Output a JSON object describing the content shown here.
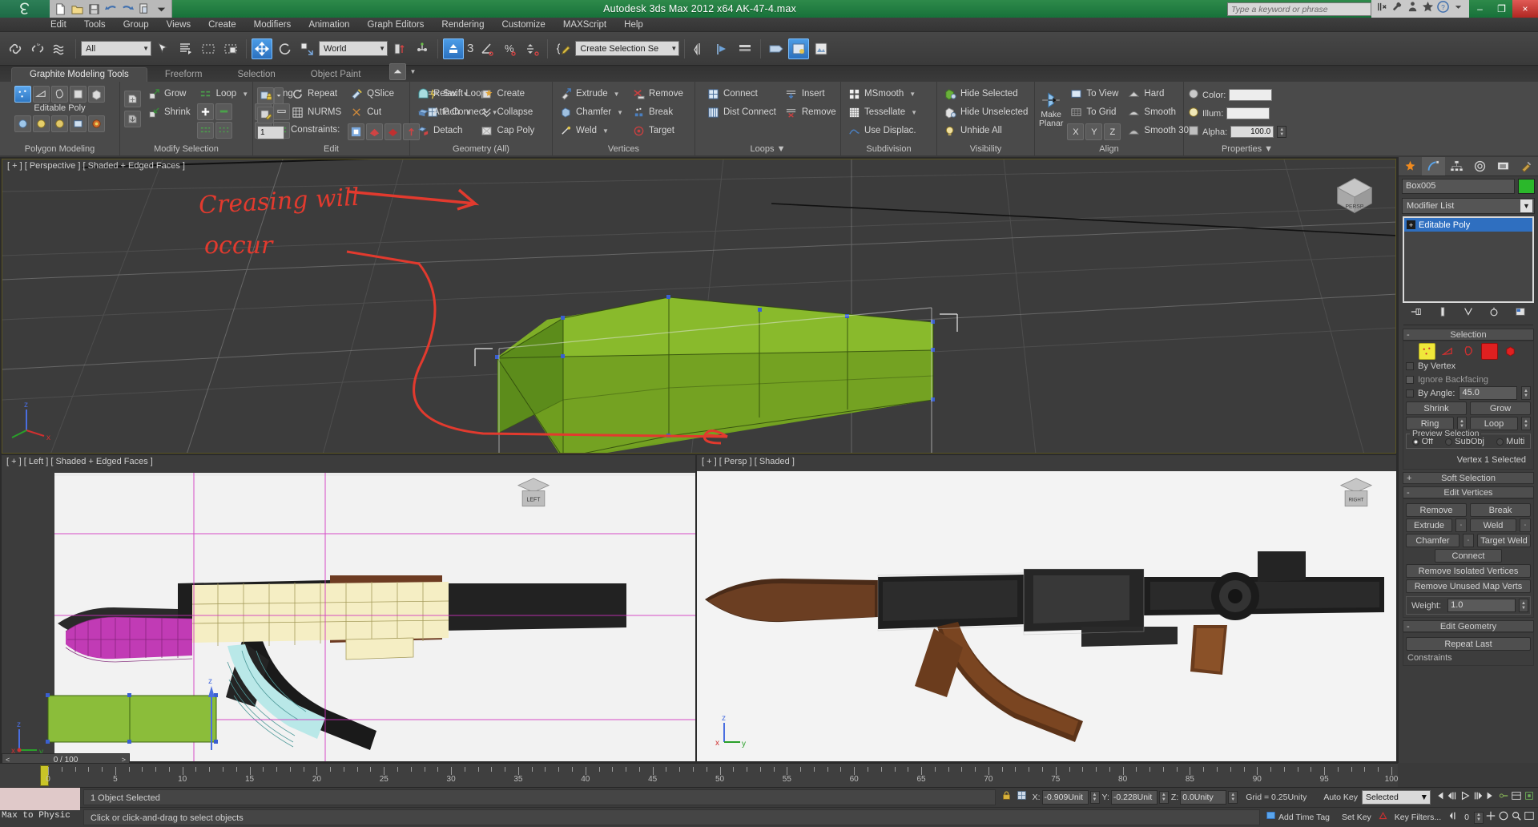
{
  "titlebar": {
    "app_title": "Autodesk 3ds Max  2012 x64    AK-47-4.max",
    "search_placeholder": "Type a keyword or phrase",
    "quick_access": [
      "new-icon",
      "open-icon",
      "save-icon",
      "undo-icon",
      "redo-icon",
      "set-project-icon"
    ],
    "window_buttons": {
      "minimize": "–",
      "restore": "❐",
      "close": "×"
    }
  },
  "menu": [
    "Edit",
    "Tools",
    "Group",
    "Views",
    "Create",
    "Modifiers",
    "Animation",
    "Graph Editors",
    "Rendering",
    "Customize",
    "MAXScript",
    "Help"
  ],
  "main_toolbar": {
    "select_filter": "All",
    "ref_coord": "World",
    "named_selection": "Create Selection Se",
    "snap_number": "3"
  },
  "ribbon": {
    "tabs": [
      "Graphite Modeling Tools",
      "Freeform",
      "Selection",
      "Object Paint"
    ],
    "active_tab": "Graphite Modeling Tools",
    "panels": [
      {
        "title": "Polygon Modeling",
        "label": "Editable Poly"
      },
      {
        "title": "Modify Selection",
        "items": [
          "Grow",
          "Shrink",
          "Loop",
          "Ring"
        ]
      },
      {
        "title": "Edit",
        "items": [
          "Repeat",
          "NURMS",
          "QSlice",
          "Cut",
          "Swift Loop",
          "P Connect",
          "Constraints:"
        ]
      },
      {
        "title": "Geometry (All)",
        "items": [
          "Relax",
          "Attach",
          "Detach",
          "Create",
          "Collapse",
          "Cap Poly"
        ]
      },
      {
        "title": "Vertices",
        "items": [
          "Extrude",
          "Chamfer",
          "Weld",
          "Remove",
          "Break",
          "Target"
        ]
      },
      {
        "title": "Loops",
        "items": [
          "Connect",
          "Dist Connect",
          "Insert",
          "Remove"
        ]
      },
      {
        "title": "Subdivision",
        "items": [
          "MSmooth",
          "Tessellate",
          "Use Displac."
        ]
      },
      {
        "title": "Visibility",
        "items": [
          "Hide Selected",
          "Hide Unselected",
          "Unhide All"
        ]
      },
      {
        "title": "Align",
        "big": "Make Planar",
        "items": [
          "To View",
          "To Grid",
          "Hard",
          "Smooth",
          "Smooth 30"
        ],
        "axes": [
          "X",
          "Y",
          "Z"
        ]
      },
      {
        "title": "Properties",
        "fields": [
          {
            "label": "Color:",
            "value": ""
          },
          {
            "label": "Illum:",
            "value": ""
          },
          {
            "label": "Alpha:",
            "value": "100.0"
          }
        ]
      }
    ]
  },
  "viewports": [
    {
      "name": "perspective",
      "label": "[ + ] [ Perspective ] [ Shaded + Edged Faces ]",
      "cube_label": "PERSPECTIVE"
    },
    {
      "name": "left",
      "label": "[ + ] [ Left ] [ Shaded + Edged Faces ]",
      "cube_label": "LEFT"
    },
    {
      "name": "persp-ref",
      "label": "[ + ] [ Persp ] [ Shaded ]",
      "cube_label": "RIGHT"
    }
  ],
  "annotations": {
    "line1": "Creasing will",
    "line2": "occur"
  },
  "command_panel": {
    "tabs": [
      "create-tab-icon",
      "modify-tab-icon",
      "hierarchy-tab-icon",
      "motion-tab-icon",
      "display-tab-icon",
      "utilities-tab-icon"
    ],
    "active_tab_index": 1,
    "object_name": "Box005",
    "object_color": "#2bb82b",
    "modifier_list_label": "Modifier List",
    "stack": [
      {
        "label": "Editable Poly",
        "selected": true
      }
    ],
    "rollouts": [
      {
        "title": "Selection",
        "expanded": true,
        "checkboxes": [
          {
            "label": "By Vertex",
            "checked": false,
            "disabled": false
          },
          {
            "label": "Ignore Backfacing",
            "checked": false,
            "disabled": true
          }
        ],
        "by_angle": {
          "label": "By Angle:",
          "value": "45.0",
          "checked": false
        },
        "buttons": [
          "Shrink",
          "Grow",
          "Ring",
          "Loop"
        ],
        "preview_selection": {
          "label": "Preview Selection",
          "options": [
            "Off",
            "SubObj",
            "Multi"
          ],
          "selected": "Off"
        },
        "status": "Vertex 1 Selected"
      },
      {
        "title": "Soft Selection",
        "expanded": false
      },
      {
        "title": "Edit Vertices",
        "expanded": true,
        "buttons": [
          "Remove",
          "Break",
          "Extrude",
          "Weld",
          "Chamfer",
          "Target Weld",
          "Connect",
          "Remove Isolated Vertices",
          "Remove Unused Map Verts"
        ],
        "weight": {
          "label": "Weight:",
          "value": "1.0"
        }
      },
      {
        "title": "Edit Geometry",
        "expanded": true,
        "buttons": [
          "Repeat Last"
        ],
        "next_label": "Constraints"
      }
    ]
  },
  "timeline": {
    "frame_indicator": "0 / 100",
    "ticks": [
      0,
      5,
      10,
      15,
      20,
      25,
      30,
      35,
      40,
      45,
      50,
      55,
      60,
      65,
      70,
      75,
      80,
      85,
      90,
      95,
      100
    ],
    "current_frame": 0
  },
  "statusbar": {
    "selection_status": "1 Object Selected",
    "prompt": "Click or click-and-drag to select objects",
    "max_script_label": "Max to Physic",
    "coords": [
      {
        "axis": "X:",
        "value": "-0.909Unit"
      },
      {
        "axis": "Y:",
        "value": "-0.228Unit"
      },
      {
        "axis": "Z:",
        "value": "0.0Unity"
      }
    ],
    "grid": "Grid = 0.25Unity",
    "add_time_tag": "Add Time Tag",
    "auto_key": "Auto Key",
    "set_key": "Set Key",
    "key_filters": "Key Filters...",
    "key_mode": "Selected",
    "key_number": "0"
  },
  "colors": {
    "title_green": "#1d7a40",
    "ribbon_bg": "#4a4a4a",
    "accent_blue": "#2f6fc0",
    "annotation_red": "#e23a2e",
    "object_green": "#7ab02a"
  }
}
